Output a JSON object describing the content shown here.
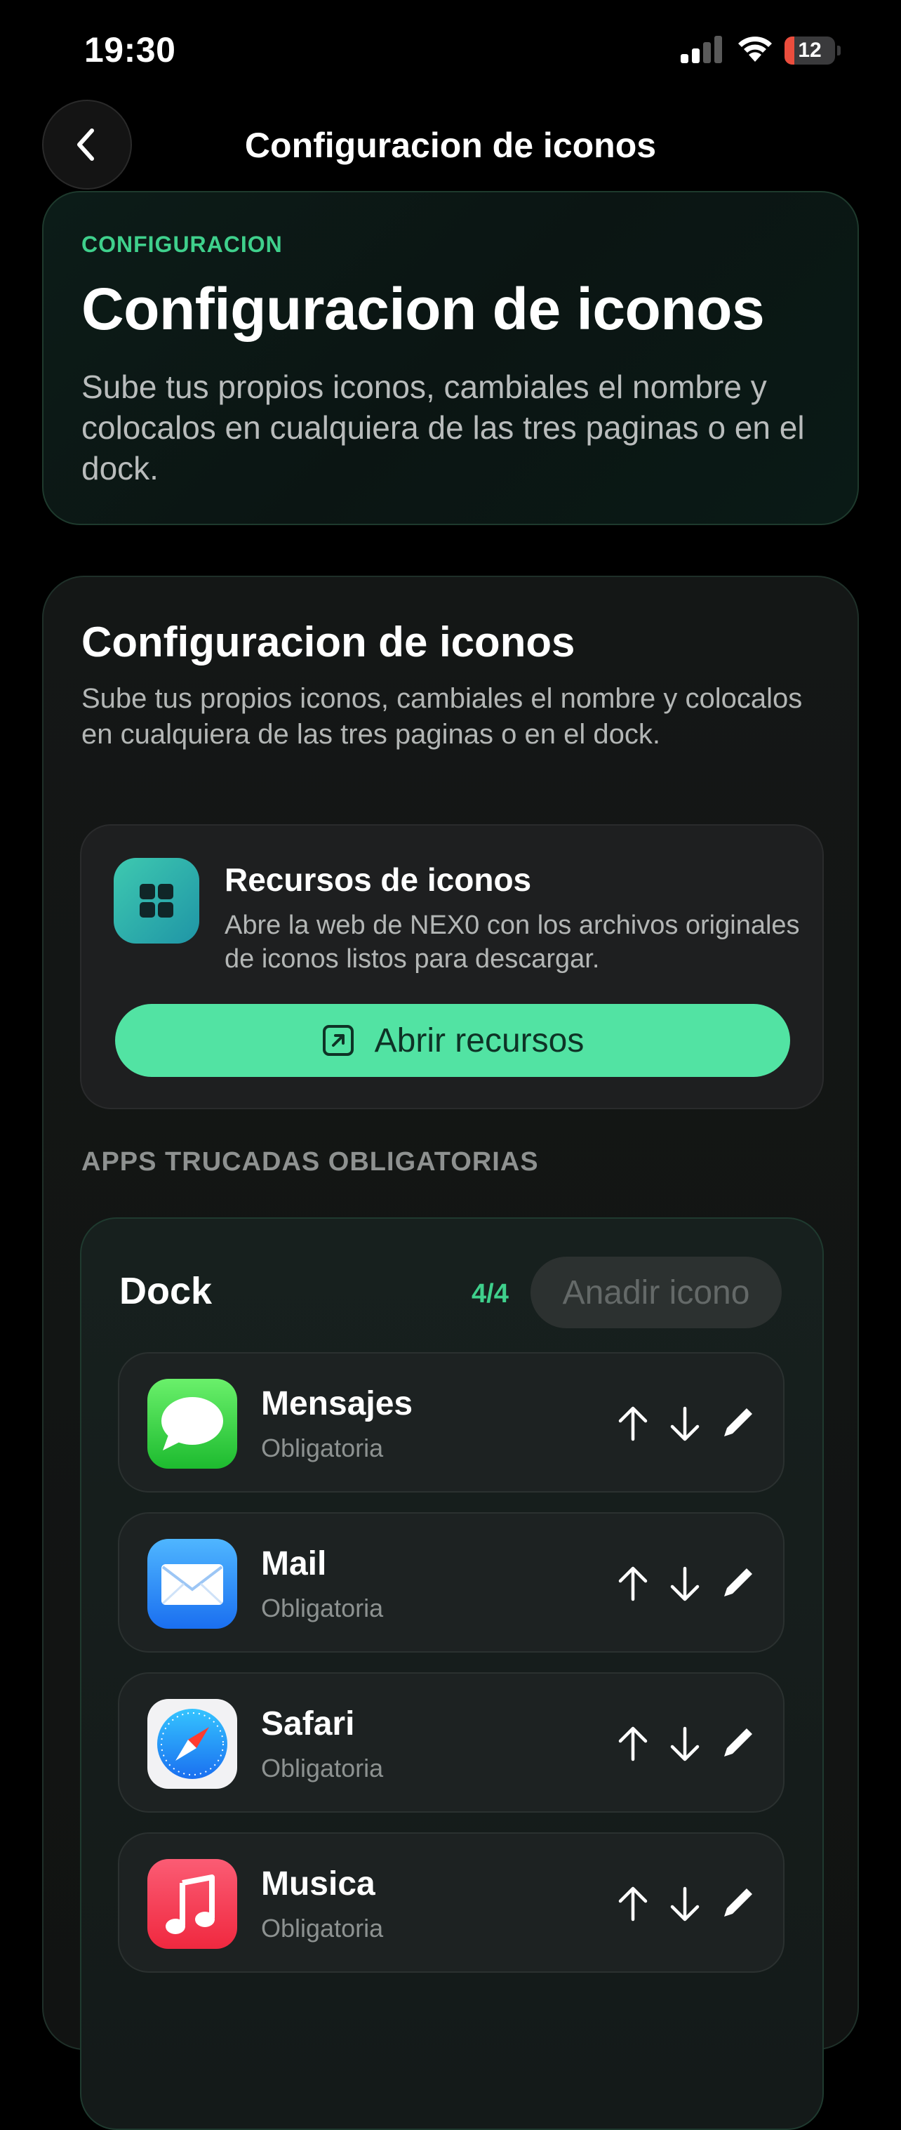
{
  "status_bar": {
    "time": "19:30",
    "battery": "12"
  },
  "nav": {
    "title": "Configuracion de iconos"
  },
  "hero": {
    "eyebrow": "CONFIGURACION",
    "title": "Configuracion de iconos",
    "description": "Sube tus propios iconos, cambiales el nombre y colocalos en cualquiera de las tres paginas o en el dock."
  },
  "card": {
    "title": "Configuracion de iconos",
    "description": "Sube tus propios iconos, cambiales el nombre y colocalos en cualquiera de las tres paginas o en el dock.",
    "resources": {
      "title": "Recursos de iconos",
      "description": "Abre la web de NEX0 con los archivos originales de iconos listos para descargar.",
      "button": "Abrir recursos"
    },
    "section_label": "APPS TRUCADAS OBLIGATORIAS",
    "dock": {
      "name": "Dock",
      "count": "4/4",
      "add_button": "Anadir icono",
      "apps": [
        {
          "name": "Mensajes",
          "status": "Obligatoria",
          "icon": "messages-icon"
        },
        {
          "name": "Mail",
          "status": "Obligatoria",
          "icon": "mail-icon"
        },
        {
          "name": "Safari",
          "status": "Obligatoria",
          "icon": "safari-icon"
        },
        {
          "name": "Musica",
          "status": "Obligatoria",
          "icon": "music-icon"
        }
      ]
    }
  },
  "colors": {
    "accent": "#52e3a3",
    "accent_text": "#3fd08c",
    "background": "#000000"
  }
}
